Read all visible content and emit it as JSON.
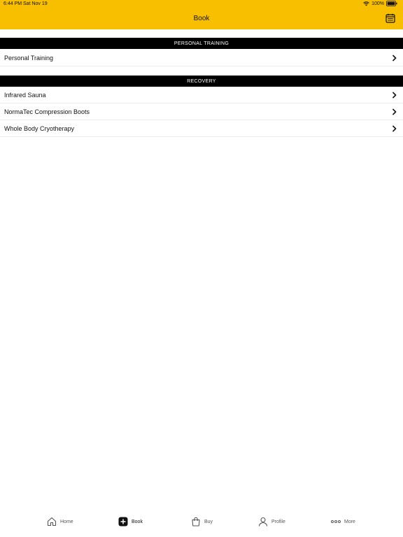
{
  "status_bar": {
    "time_date": "6:44 PM  Sat Nov 19",
    "battery": "100%"
  },
  "nav": {
    "title": "Book",
    "right_icon": "calendar-icon"
  },
  "sections": [
    {
      "header": "PERSONAL TRAINING",
      "items": [
        {
          "label": "Personal Training"
        }
      ]
    },
    {
      "header": "RECOVERY",
      "items": [
        {
          "label": "Infrared Sauna"
        },
        {
          "label": "NormaTec Compression Boots"
        },
        {
          "label": "Whole Body Cryotherapy"
        }
      ]
    }
  ],
  "tabs": [
    {
      "label": "Home",
      "icon": "home-icon"
    },
    {
      "label": "Book",
      "icon": "plus-square-icon",
      "active": true
    },
    {
      "label": "Buy",
      "icon": "shopping-bag-icon"
    },
    {
      "label": "Profile",
      "icon": "person-icon"
    },
    {
      "label": "More",
      "icon": "more-dots-icon"
    }
  ],
  "colors": {
    "header_bg": "#f8bf00",
    "section_header_bg": "#000000",
    "section_header_text": "#ffffff"
  }
}
